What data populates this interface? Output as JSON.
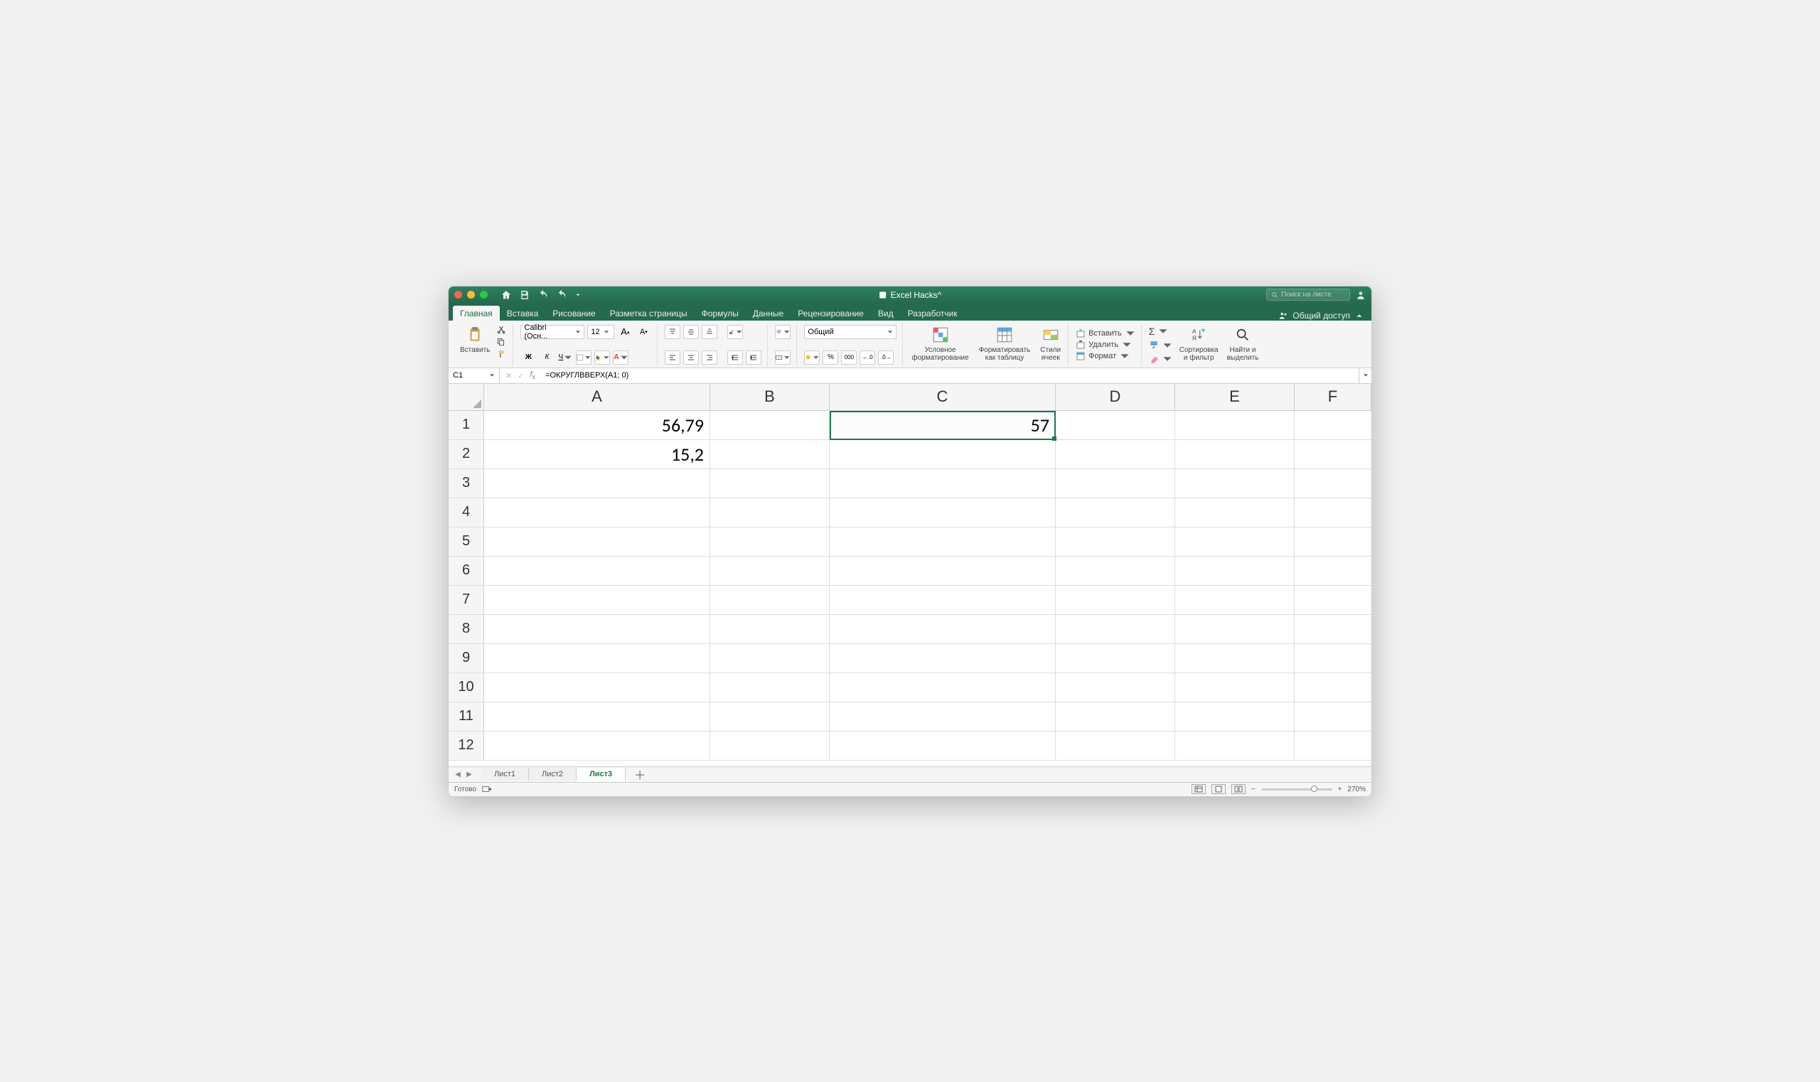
{
  "titlebar": {
    "title": "Excel Hacks^",
    "search_placeholder": "Поиск на листе"
  },
  "tabs": {
    "items": [
      "Главная",
      "Вставка",
      "Рисование",
      "Разметка страницы",
      "Формулы",
      "Данные",
      "Рецензирование",
      "Вид",
      "Разработчик"
    ],
    "active": 0,
    "share_label": "Общий доступ"
  },
  "ribbon": {
    "paste_label": "Вставить",
    "font_name": "Calibri (Осн...",
    "font_size": "12",
    "number_format": "Общий",
    "cond_fmt": "Условное\nформатирование",
    "table_fmt": "Форматировать\nкак таблицу",
    "cell_styles": "Стили\nячеек",
    "insert_label": "Вставить",
    "delete_label": "Удалить",
    "format_label": "Формат",
    "sort_label": "Сортировка\nи фильтр",
    "find_label": "Найти и\nвыделить"
  },
  "formula_bar": {
    "cell_ref": "C1",
    "formula": "=ОКРУГЛВВЕРХ(A1; 0)"
  },
  "grid": {
    "columns": [
      "A",
      "B",
      "C",
      "D",
      "E",
      "F"
    ],
    "rows": [
      {
        "n": "1",
        "A": "56,79",
        "C": "57"
      },
      {
        "n": "2",
        "A": "15,2"
      },
      {
        "n": "3"
      },
      {
        "n": "4"
      },
      {
        "n": "5"
      },
      {
        "n": "6"
      },
      {
        "n": "7"
      },
      {
        "n": "8"
      },
      {
        "n": "9"
      },
      {
        "n": "10"
      },
      {
        "n": "11"
      },
      {
        "n": "12"
      }
    ],
    "selected_cell": "C1"
  },
  "sheets": {
    "tabs": [
      "Лист1",
      "Лист2",
      "Лист3"
    ],
    "active": 2
  },
  "statusbar": {
    "ready": "Готово",
    "zoom": "270%"
  }
}
